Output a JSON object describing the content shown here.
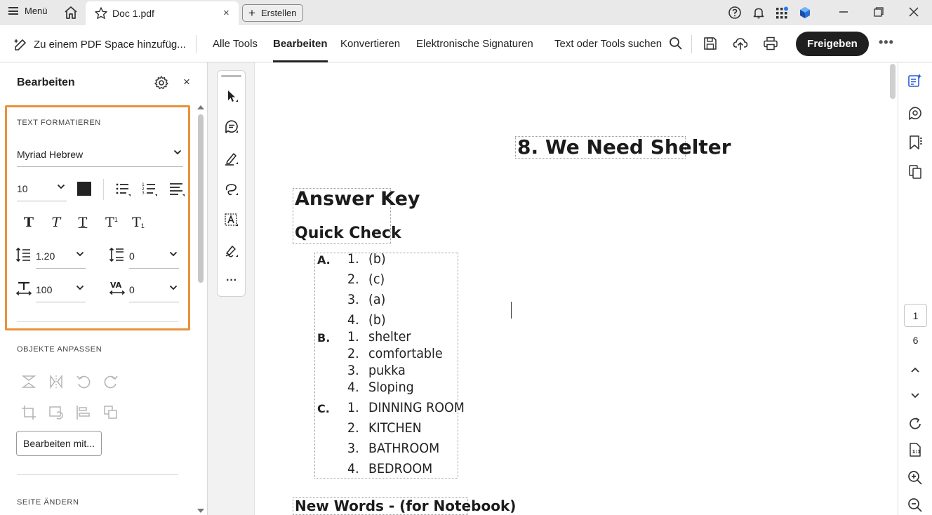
{
  "titlebar": {
    "menu_label": "Menü",
    "tab_title": "Doc 1.pdf",
    "tab_close": "×",
    "create_label": "Erstellen"
  },
  "toolbar": {
    "add_to_space": "Zu einem PDF Space hinzufüg...",
    "nav": [
      "Alle Tools",
      "Bearbeiten",
      "Konvertieren",
      "Elektronische Signaturen"
    ],
    "active_nav": "Bearbeiten",
    "search_label": "Text oder Tools suchen",
    "share_label": "Freigeben"
  },
  "left_panel": {
    "title": "Bearbeiten",
    "close": "×",
    "text_format_heading": "TEXT FORMATIEREN",
    "font_family": "Myriad Hebrew",
    "font_size": "10",
    "text_color": "#222222",
    "line_spacing": "1.20",
    "paragraph_spacing": "0",
    "horizontal_scale": "100",
    "char_spacing": "0",
    "style_buttons": [
      "T",
      "T",
      "T",
      "T",
      "T"
    ],
    "objects_heading": "OBJEKTE ANPASSEN",
    "edit_with_label": "Bearbeiten mit...",
    "page_heading": "SEITE ÄNDERN"
  },
  "document": {
    "chapter_title": "8.  We Need Shelter",
    "answer_key": "Answer Key",
    "quick_check": "Quick Check",
    "sections": [
      {
        "letter": "A.",
        "items": [
          {
            "num": "1.",
            "text": "(b)"
          },
          {
            "num": "2.",
            "text": "(c)"
          },
          {
            "num": "3.",
            "text": "(a)"
          },
          {
            "num": "4.",
            "text": "(b)"
          }
        ]
      },
      {
        "letter": "B.",
        "items": [
          {
            "num": "1.",
            "text": "shelter"
          },
          {
            "num": "2.",
            "text": "comfortable"
          },
          {
            "num": "3.",
            "text": "pukka"
          },
          {
            "num": "4.",
            "text": "Sloping"
          }
        ]
      },
      {
        "letter": "C.",
        "items": [
          {
            "num": "1.",
            "text": "DINNING ROOM"
          },
          {
            "num": "2.",
            "text": "KITCHEN"
          },
          {
            "num": "3.",
            "text": "BATHROOM"
          },
          {
            "num": "4.",
            "text": "BEDROOM"
          }
        ]
      }
    ],
    "new_words": "New Words - (for Notebook)"
  },
  "right_rail": {
    "current_page": "1",
    "total_pages": "6"
  },
  "colors": {
    "highlight_border": "#e8923a",
    "share_button": "#1f1f1f",
    "accent_blue": "#2a5bd7"
  }
}
